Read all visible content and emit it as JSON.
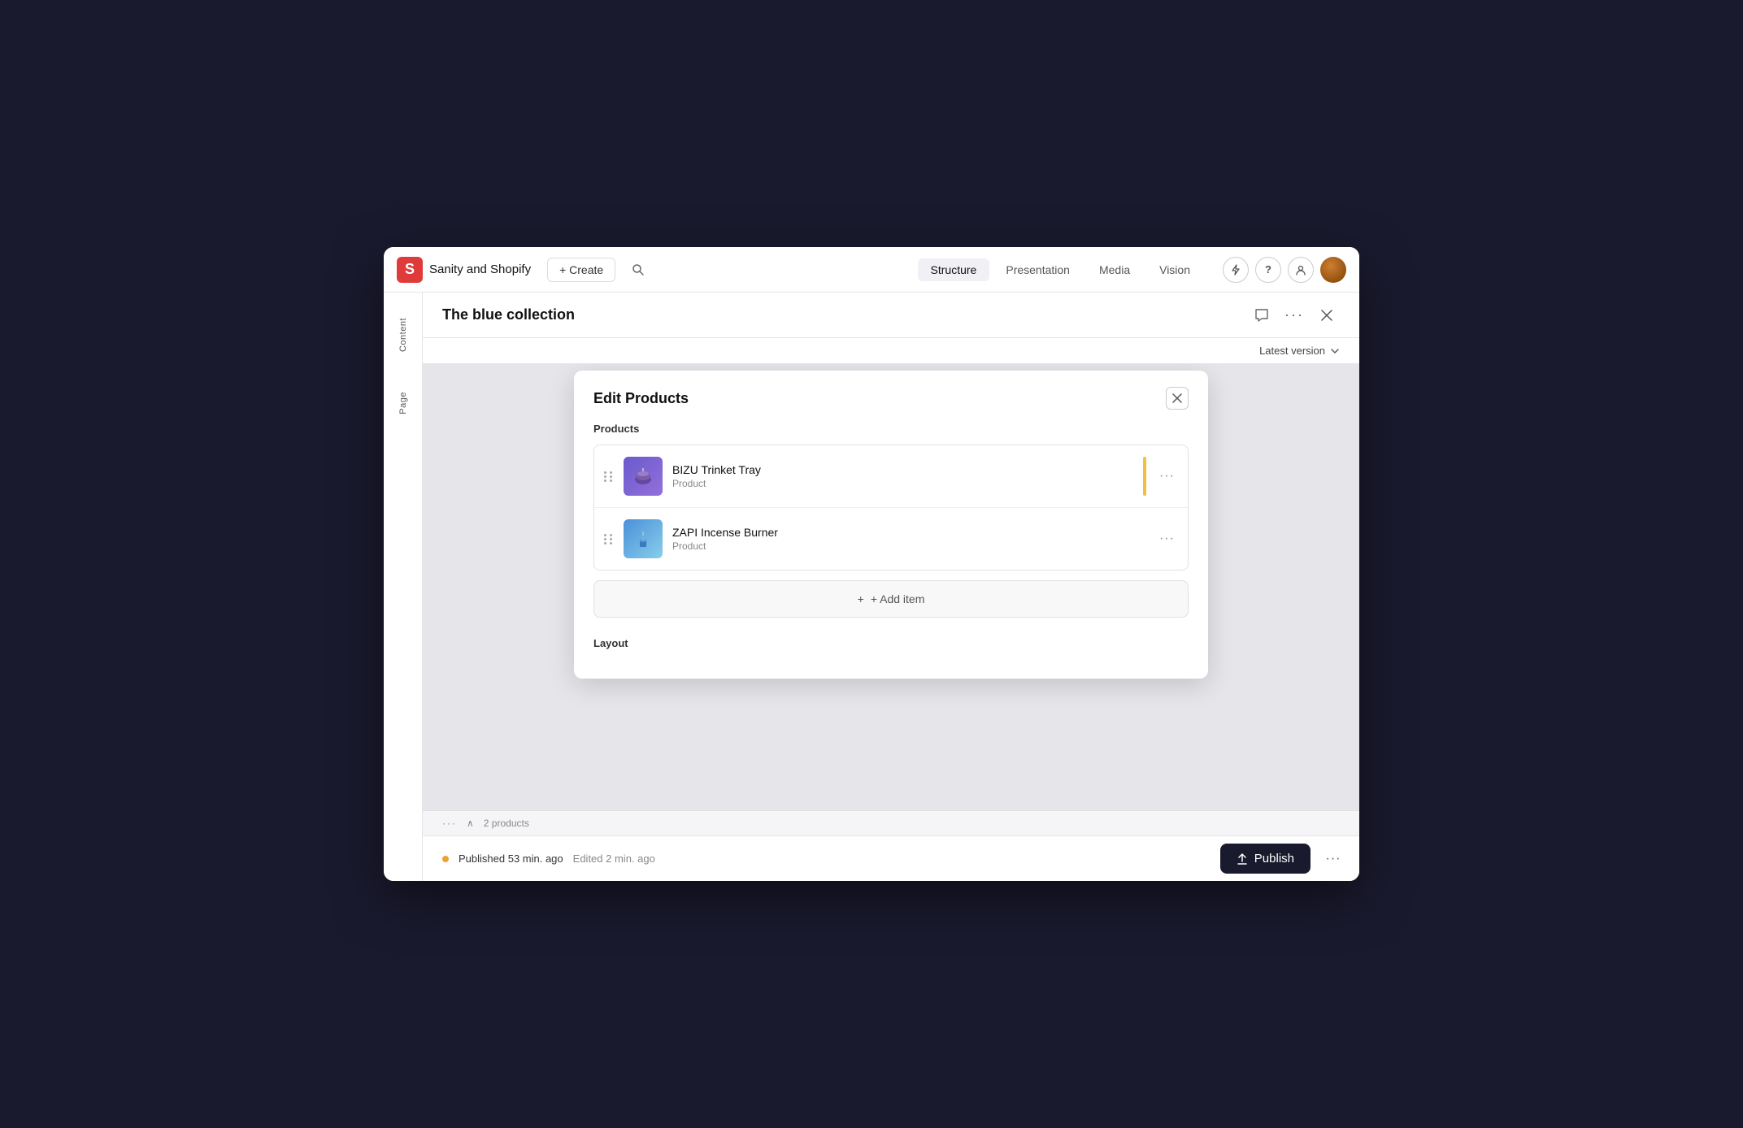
{
  "app": {
    "brand_logo": "S",
    "brand_name": "Sanity and Shopify",
    "create_label": "+ Create",
    "nav_tabs": [
      {
        "id": "structure",
        "label": "Structure",
        "active": true
      },
      {
        "id": "presentation",
        "label": "Presentation",
        "active": false
      },
      {
        "id": "media",
        "label": "Media",
        "active": false
      },
      {
        "id": "vision",
        "label": "Vision",
        "active": false
      }
    ]
  },
  "sidebar": {
    "tabs": [
      {
        "id": "content",
        "label": "Content"
      },
      {
        "id": "page",
        "label": "Page"
      }
    ]
  },
  "document": {
    "title": "The blue collection",
    "version_label": "Latest version"
  },
  "modal": {
    "title": "Edit Products",
    "section_label": "Products",
    "products": [
      {
        "id": "bizu",
        "name": "BIZU Trinket Tray",
        "type": "Product",
        "emoji": "🫙"
      },
      {
        "id": "zapi",
        "name": "ZAPI Incense Burner",
        "type": "Product",
        "emoji": "🕯️"
      }
    ],
    "add_item_label": "+ Add item",
    "layout_label": "Layout"
  },
  "bottom_bar": {
    "published_text": "Published 53 min. ago",
    "edited_text": "Edited 2 min. ago",
    "publish_label": "Publish",
    "more_icon": "···"
  },
  "icons": {
    "search": "🔍",
    "chat": "💬",
    "more": "···",
    "close": "✕",
    "chevron_down": "∨",
    "lightning": "⚡",
    "help": "?",
    "user": "👤",
    "drag": "⠿",
    "plus": "+",
    "publish_arrow": "↑"
  }
}
